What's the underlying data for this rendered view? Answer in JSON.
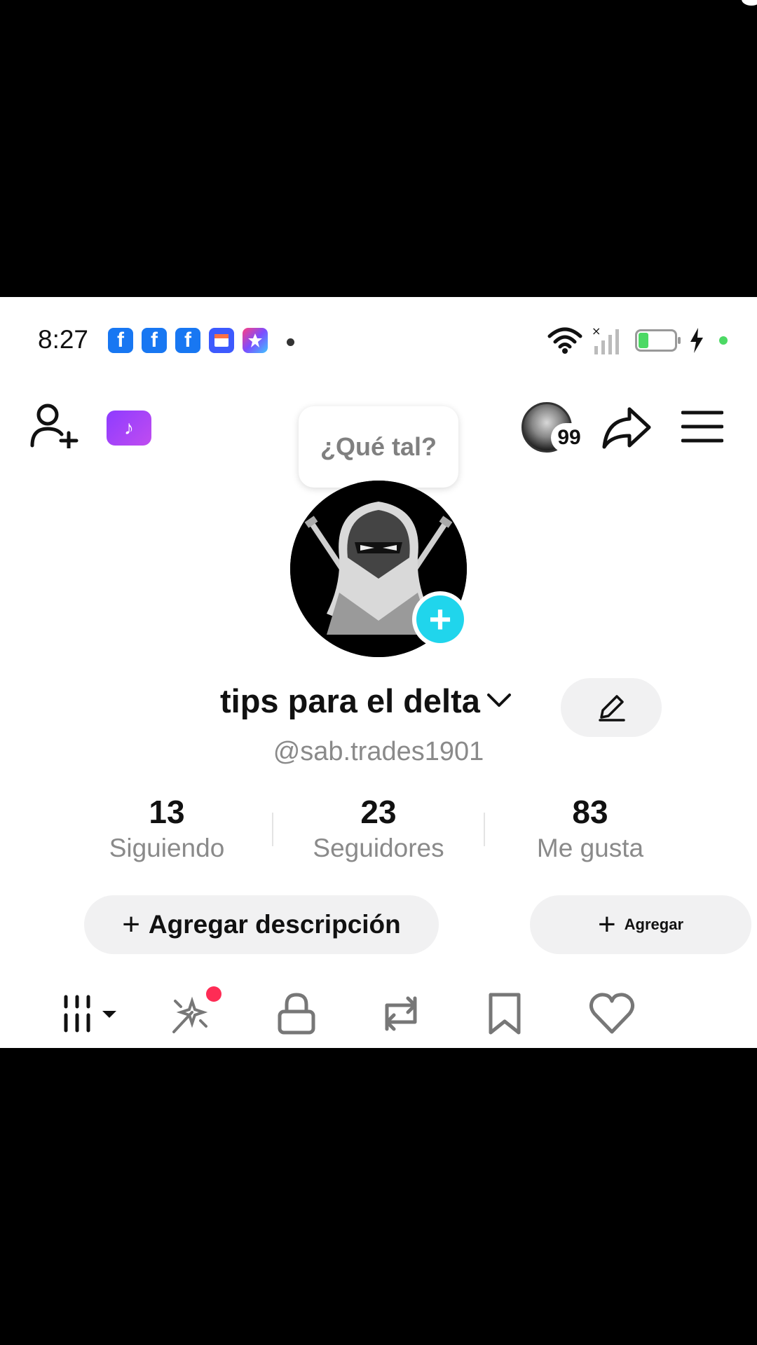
{
  "status_bar": {
    "time": "8:27",
    "battery_level": "6"
  },
  "header": {
    "tooltip": "¿Qué tal?",
    "notification_count": "99"
  },
  "profile": {
    "display_name": "tips para el delta",
    "username": "@sab.trades1901"
  },
  "stats": [
    {
      "value": "13",
      "label": "Siguiendo"
    },
    {
      "value": "23",
      "label": "Seguidores"
    },
    {
      "value": "83",
      "label": "Me gusta"
    }
  ],
  "actions": {
    "add_description": "Agregar descripción",
    "add": "Agregar"
  },
  "tabs": [
    {
      "icon": "grid-icon"
    },
    {
      "icon": "sparkle-icon",
      "has_dot": true
    },
    {
      "icon": "lock-icon"
    },
    {
      "icon": "repost-icon"
    },
    {
      "icon": "bookmark-icon"
    },
    {
      "icon": "heart-icon"
    }
  ],
  "colors": {
    "accent": "#20d5ec",
    "notification_dot": "#fe2c55",
    "facebook": "#1877f2"
  }
}
